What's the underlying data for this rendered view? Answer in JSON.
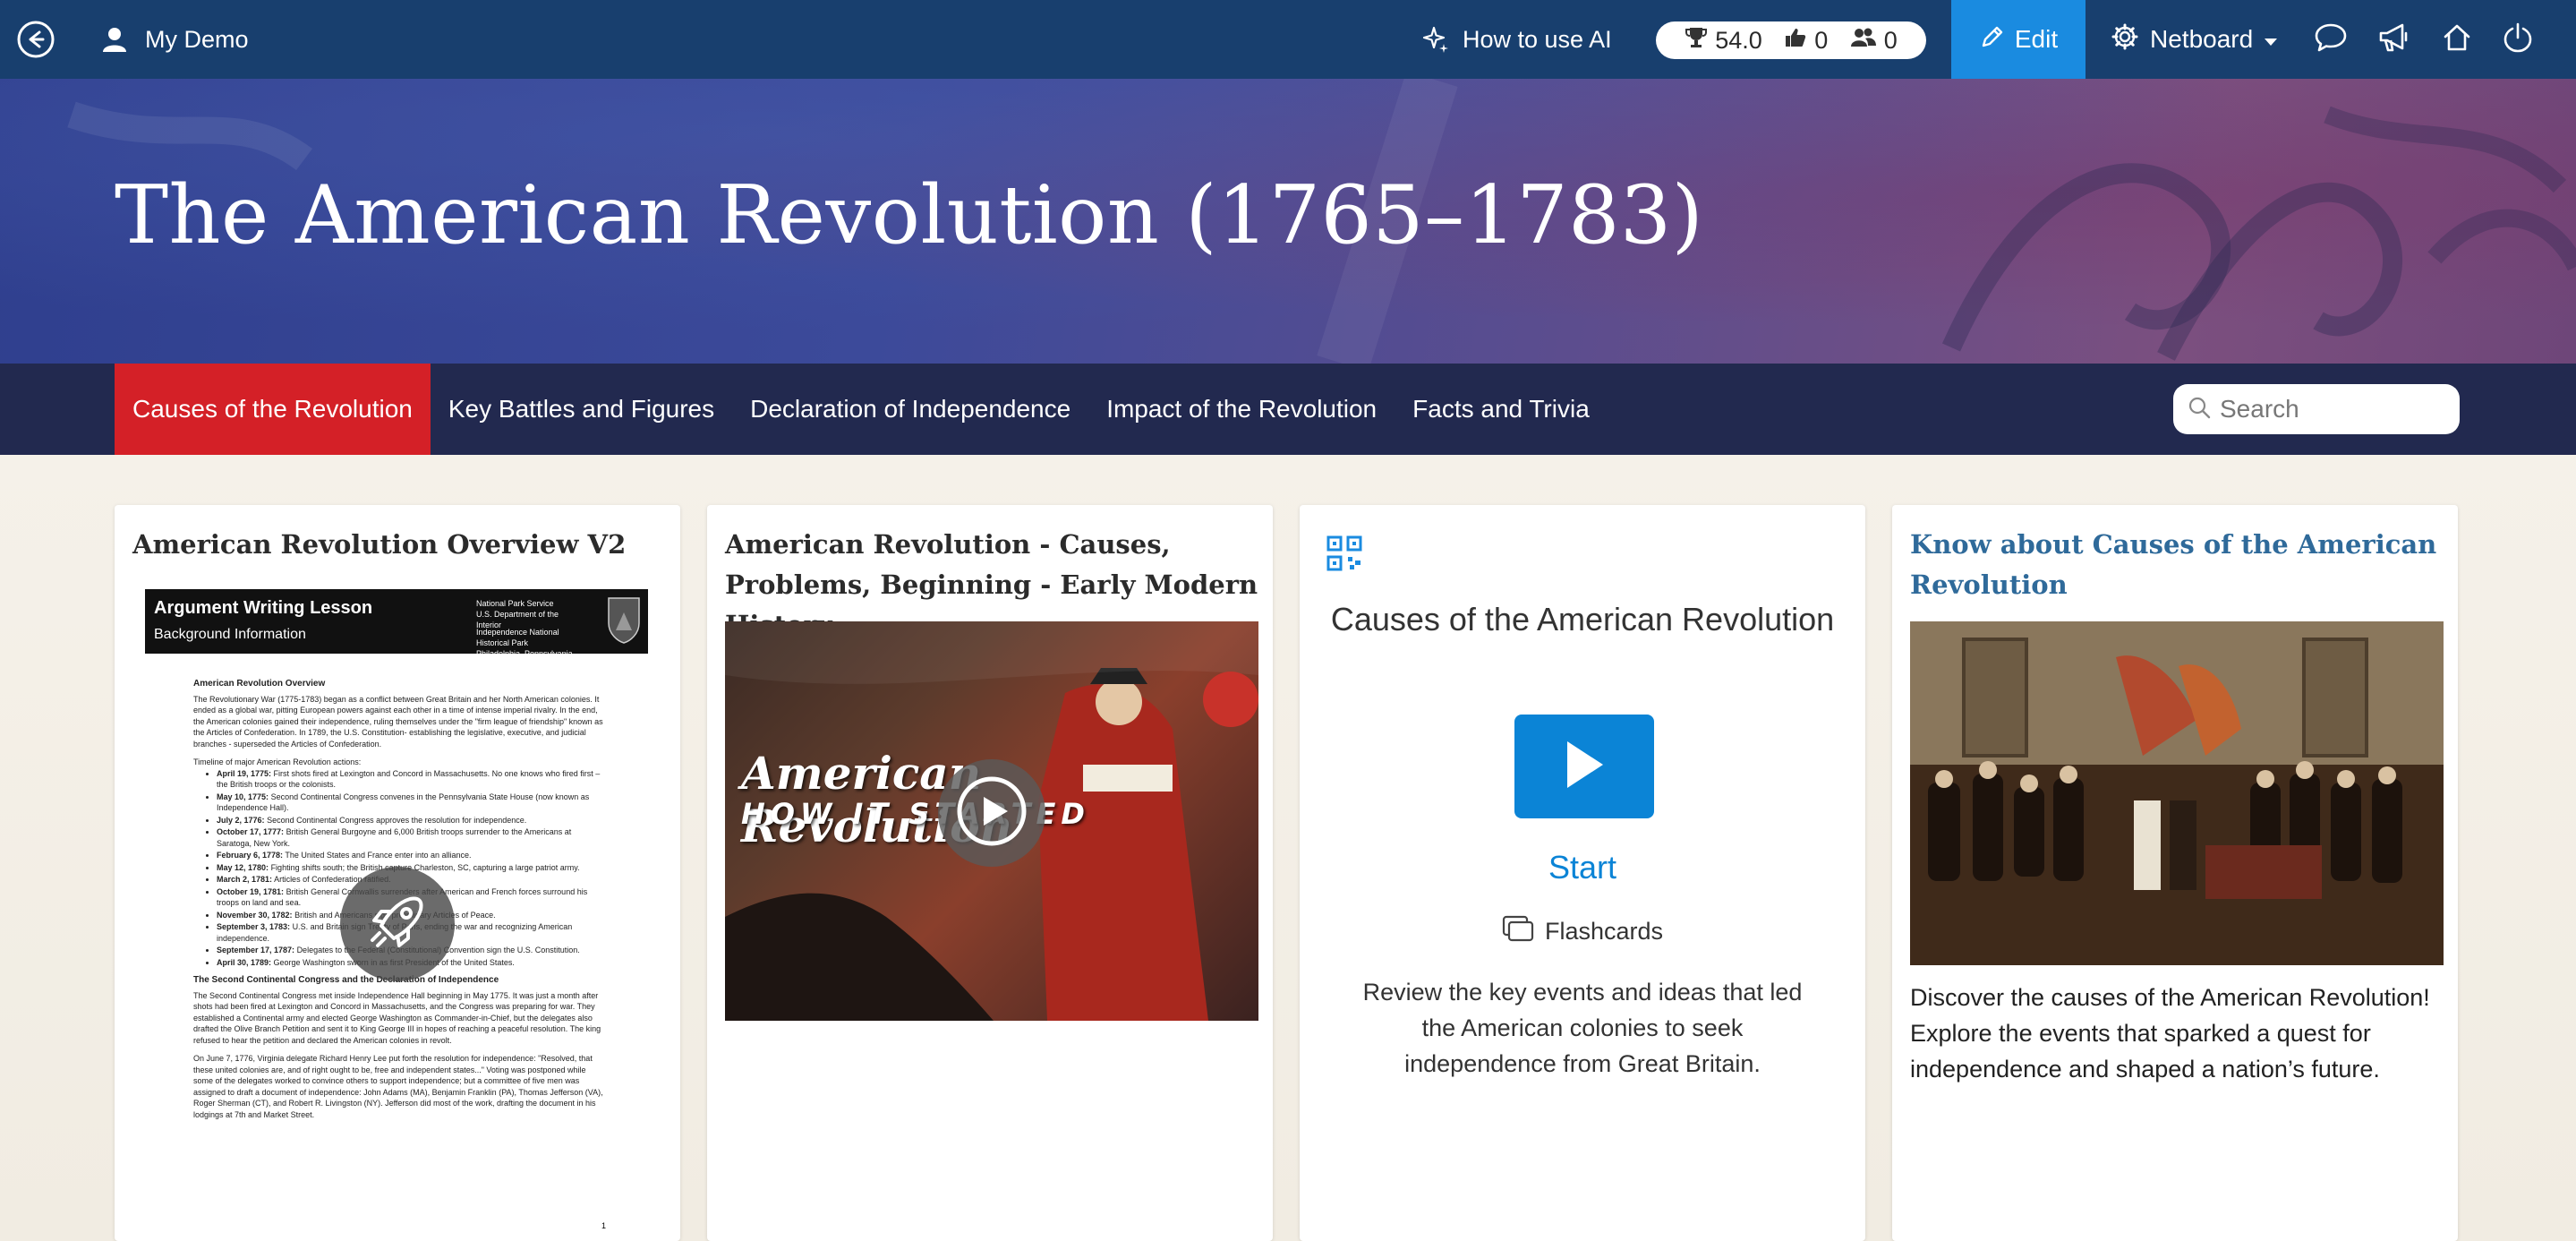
{
  "topbar": {
    "user_name": "My Demo",
    "ai_label": "How to use AI",
    "stats": {
      "score": "54.0",
      "likes": "0",
      "members": "0"
    },
    "edit_label": "Edit",
    "board_label": "Netboard",
    "icons": [
      "back-arrow-icon",
      "user-icon",
      "sparkle-icon",
      "trophy-icon",
      "thumbs-up-icon",
      "users-icon",
      "pencil-icon",
      "gear-icon",
      "caret-down-icon",
      "chat-icon",
      "megaphone-icon",
      "home-icon",
      "power-icon"
    ]
  },
  "hero": {
    "title": "The American Revolution (1765–1783)"
  },
  "nav": {
    "tabs": [
      {
        "label": "Causes of the Revolution",
        "active": true
      },
      {
        "label": "Key Battles and Figures",
        "active": false
      },
      {
        "label": "Declaration of Independence",
        "active": false
      },
      {
        "label": "Impact of the Revolution",
        "active": false
      },
      {
        "label": "Facts and Trivia",
        "active": false
      }
    ],
    "search_placeholder": "Search"
  },
  "cards": [
    {
      "title": "American Revolution Overview V2",
      "doc": {
        "header_title": "Argument Writing Lesson",
        "header_subtitle": "Background Information",
        "agency_1": "National Park Service",
        "agency_2": "U.S. Department of the Interior",
        "agency_3": "Independence National Historical Park",
        "agency_4": "Philadelphia, Pennsylvania",
        "section_1": "American Revolution Overview",
        "intro": "The Revolutionary War (1775-1783) began as a conflict between Great Britain and her North American colonies. It ended as a global war, pitting European powers against each other in a time of intense imperial rivalry. In the end, the American colonies gained their independence, ruling themselves under the \"firm league of friendship\" known as the Articles of Confederation. In 1789, the U.S. Constitution- establishing the legislative, executive, and judicial branches - superseded the Articles of Confederation.",
        "timeline_label": "Timeline of major American Revolution actions:",
        "timeline": [
          {
            "date": "April 19, 1775:",
            "text": "First shots fired at Lexington and Concord in Massachusetts. No one knows who fired first – the British troops or the colonists."
          },
          {
            "date": "May 10, 1775:",
            "text": "Second Continental Congress convenes in the Pennsylvania State House (now known as Independence Hall)."
          },
          {
            "date": "July 2, 1776:",
            "text": "Second Continental Congress approves the resolution for independence."
          },
          {
            "date": "October 17, 1777:",
            "text": "British General Burgoyne and 6,000 British troops surrender to the Americans at Saratoga, New York."
          },
          {
            "date": "February 6, 1778:",
            "text": "The United States and France enter into an alliance."
          },
          {
            "date": "May 12, 1780:",
            "text": "Fighting shifts south; the British capture Charleston, SC, capturing a large patriot army."
          },
          {
            "date": "March 2, 1781:",
            "text": "Articles of Confederation ratified."
          },
          {
            "date": "October 19, 1781:",
            "text": "British General Cornwallis surrenders after American and French forces surround his troops on land and sea."
          },
          {
            "date": "November 30, 1782:",
            "text": "British and Americans sign preliminary Articles of Peace."
          },
          {
            "date": "September 3, 1783:",
            "text": "U.S. and Britain sign Treaty of Paris, ending the war and recognizing American independence."
          },
          {
            "date": "September 17, 1787:",
            "text": "Delegates to the Federal (Constitutional) Convention sign the U.S. Constitution."
          },
          {
            "date": "April 30, 1789:",
            "text": "George Washington sworn in as first President of the United States."
          }
        ],
        "section_2": "The Second Continental Congress and the Declaration of Independence",
        "para_2": "The Second Continental Congress met inside Independence Hall beginning in May 1775. It was just a month after shots had been fired at Lexington and Concord in Massachusetts, and the Congress was preparing for war. They established a Continental army and elected George Washington as Commander-in-Chief, but the delegates also drafted the Olive Branch Petition and sent it to King George III in hopes of reaching a peaceful resolution. The king refused to hear the petition and declared the American colonies in revolt.",
        "para_3": "On June 7, 1776, Virginia delegate Richard Henry Lee put forth the resolution for independence: \"Resolved, that these united colonies are, and of right ought to be, free and independent states...\" Voting was postponed while some of the delegates worked to convince others to support independence; but a committee of five men was assigned to draft a document of independence: John Adams (MA), Benjamin Franklin (PA), Thomas Jefferson (VA), Roger Sherman (CT), and Robert R. Livingston (NY). Jefferson did most of the work, drafting the document in his lodgings at 7th and Market Street.",
        "page_number": "1"
      }
    },
    {
      "title": "American Revolution - Causes, Problems, Beginning - Early Modern History",
      "video_line_1": "American Revolution",
      "video_line_2": "HOW IT STARTED"
    },
    {
      "title": "Causes of the American Revolution",
      "start_label": "Start",
      "type_label": "Flashcards",
      "description": "Review the key events and ideas that led the American colonies to seek independence from Great Britain."
    },
    {
      "title": "Know about Causes of the American Revolution",
      "description": "Discover the causes of the American Revolution! Explore the events that sparked a quest for independence and shaped a nation’s future."
    }
  ],
  "colors": {
    "topbar": "#183f6e",
    "edit": "#1a8be0",
    "nav": "#22294f",
    "active_tab": "#d42027",
    "link": "#2f6a9a",
    "flashcard_blue": "#0b84d6"
  }
}
